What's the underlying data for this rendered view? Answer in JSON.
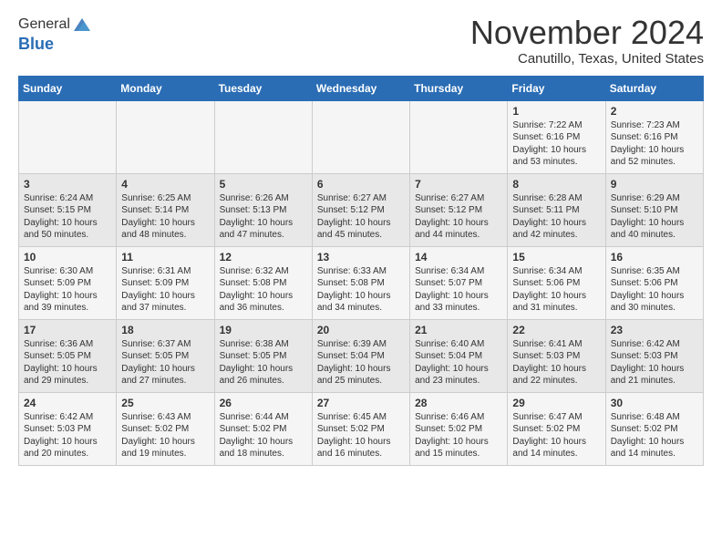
{
  "header": {
    "logo_general": "General",
    "logo_blue": "Blue",
    "title": "November 2024",
    "subtitle": "Canutillo, Texas, United States"
  },
  "columns": [
    "Sunday",
    "Monday",
    "Tuesday",
    "Wednesday",
    "Thursday",
    "Friday",
    "Saturday"
  ],
  "rows": [
    [
      {
        "day": "",
        "info": ""
      },
      {
        "day": "",
        "info": ""
      },
      {
        "day": "",
        "info": ""
      },
      {
        "day": "",
        "info": ""
      },
      {
        "day": "",
        "info": ""
      },
      {
        "day": "1",
        "info": "Sunrise: 7:22 AM\nSunset: 6:16 PM\nDaylight: 10 hours\nand 53 minutes."
      },
      {
        "day": "2",
        "info": "Sunrise: 7:23 AM\nSunset: 6:16 PM\nDaylight: 10 hours\nand 52 minutes."
      }
    ],
    [
      {
        "day": "3",
        "info": "Sunrise: 6:24 AM\nSunset: 5:15 PM\nDaylight: 10 hours\nand 50 minutes."
      },
      {
        "day": "4",
        "info": "Sunrise: 6:25 AM\nSunset: 5:14 PM\nDaylight: 10 hours\nand 48 minutes."
      },
      {
        "day": "5",
        "info": "Sunrise: 6:26 AM\nSunset: 5:13 PM\nDaylight: 10 hours\nand 47 minutes."
      },
      {
        "day": "6",
        "info": "Sunrise: 6:27 AM\nSunset: 5:12 PM\nDaylight: 10 hours\nand 45 minutes."
      },
      {
        "day": "7",
        "info": "Sunrise: 6:27 AM\nSunset: 5:12 PM\nDaylight: 10 hours\nand 44 minutes."
      },
      {
        "day": "8",
        "info": "Sunrise: 6:28 AM\nSunset: 5:11 PM\nDaylight: 10 hours\nand 42 minutes."
      },
      {
        "day": "9",
        "info": "Sunrise: 6:29 AM\nSunset: 5:10 PM\nDaylight: 10 hours\nand 40 minutes."
      }
    ],
    [
      {
        "day": "10",
        "info": "Sunrise: 6:30 AM\nSunset: 5:09 PM\nDaylight: 10 hours\nand 39 minutes."
      },
      {
        "day": "11",
        "info": "Sunrise: 6:31 AM\nSunset: 5:09 PM\nDaylight: 10 hours\nand 37 minutes."
      },
      {
        "day": "12",
        "info": "Sunrise: 6:32 AM\nSunset: 5:08 PM\nDaylight: 10 hours\nand 36 minutes."
      },
      {
        "day": "13",
        "info": "Sunrise: 6:33 AM\nSunset: 5:08 PM\nDaylight: 10 hours\nand 34 minutes."
      },
      {
        "day": "14",
        "info": "Sunrise: 6:34 AM\nSunset: 5:07 PM\nDaylight: 10 hours\nand 33 minutes."
      },
      {
        "day": "15",
        "info": "Sunrise: 6:34 AM\nSunset: 5:06 PM\nDaylight: 10 hours\nand 31 minutes."
      },
      {
        "day": "16",
        "info": "Sunrise: 6:35 AM\nSunset: 5:06 PM\nDaylight: 10 hours\nand 30 minutes."
      }
    ],
    [
      {
        "day": "17",
        "info": "Sunrise: 6:36 AM\nSunset: 5:05 PM\nDaylight: 10 hours\nand 29 minutes."
      },
      {
        "day": "18",
        "info": "Sunrise: 6:37 AM\nSunset: 5:05 PM\nDaylight: 10 hours\nand 27 minutes."
      },
      {
        "day": "19",
        "info": "Sunrise: 6:38 AM\nSunset: 5:05 PM\nDaylight: 10 hours\nand 26 minutes."
      },
      {
        "day": "20",
        "info": "Sunrise: 6:39 AM\nSunset: 5:04 PM\nDaylight: 10 hours\nand 25 minutes."
      },
      {
        "day": "21",
        "info": "Sunrise: 6:40 AM\nSunset: 5:04 PM\nDaylight: 10 hours\nand 23 minutes."
      },
      {
        "day": "22",
        "info": "Sunrise: 6:41 AM\nSunset: 5:03 PM\nDaylight: 10 hours\nand 22 minutes."
      },
      {
        "day": "23",
        "info": "Sunrise: 6:42 AM\nSunset: 5:03 PM\nDaylight: 10 hours\nand 21 minutes."
      }
    ],
    [
      {
        "day": "24",
        "info": "Sunrise: 6:42 AM\nSunset: 5:03 PM\nDaylight: 10 hours\nand 20 minutes."
      },
      {
        "day": "25",
        "info": "Sunrise: 6:43 AM\nSunset: 5:02 PM\nDaylight: 10 hours\nand 19 minutes."
      },
      {
        "day": "26",
        "info": "Sunrise: 6:44 AM\nSunset: 5:02 PM\nDaylight: 10 hours\nand 18 minutes."
      },
      {
        "day": "27",
        "info": "Sunrise: 6:45 AM\nSunset: 5:02 PM\nDaylight: 10 hours\nand 16 minutes."
      },
      {
        "day": "28",
        "info": "Sunrise: 6:46 AM\nSunset: 5:02 PM\nDaylight: 10 hours\nand 15 minutes."
      },
      {
        "day": "29",
        "info": "Sunrise: 6:47 AM\nSunset: 5:02 PM\nDaylight: 10 hours\nand 14 minutes."
      },
      {
        "day": "30",
        "info": "Sunrise: 6:48 AM\nSunset: 5:02 PM\nDaylight: 10 hours\nand 14 minutes."
      }
    ]
  ]
}
